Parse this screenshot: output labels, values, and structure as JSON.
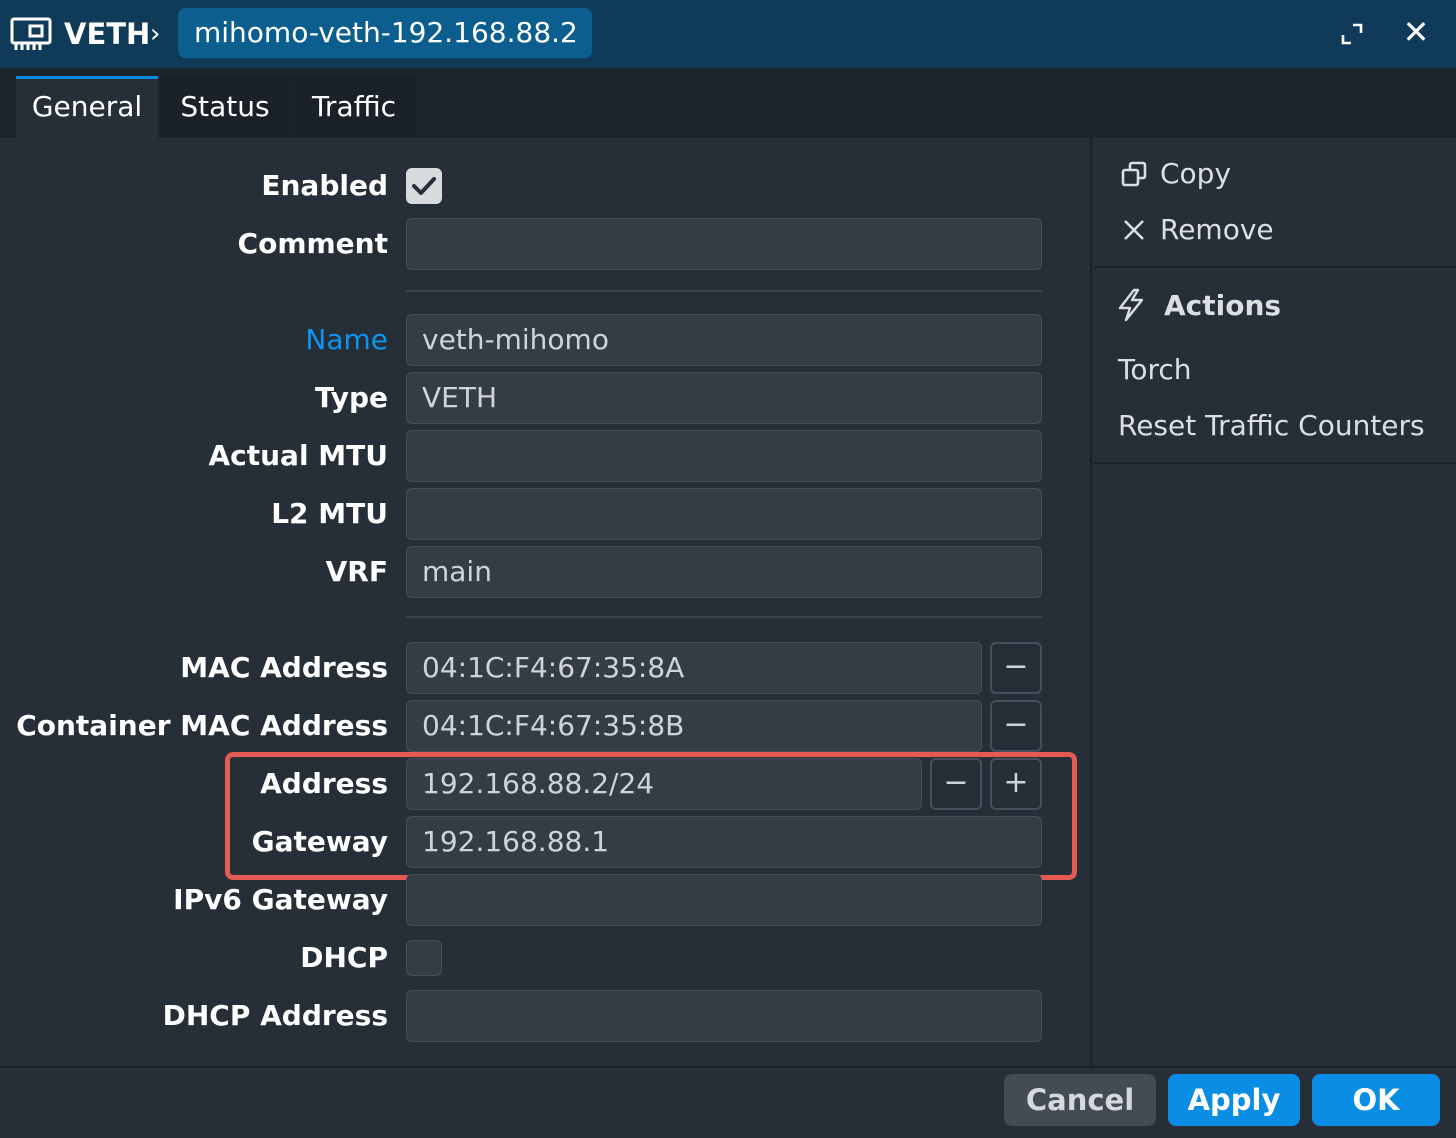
{
  "titlebar": {
    "type_label": "VETH",
    "separator": "›",
    "item_name": "mihomo-veth-192.168.88.2",
    "close_glyph": "✕"
  },
  "tabs": [
    {
      "label": "General",
      "active": true
    },
    {
      "label": "Status",
      "active": false
    },
    {
      "label": "Traffic",
      "active": false
    }
  ],
  "form": {
    "enabled": {
      "label": "Enabled",
      "checked": true
    },
    "comment": {
      "label": "Comment",
      "value": ""
    },
    "name": {
      "label": "Name",
      "value": "veth-mihomo"
    },
    "type": {
      "label": "Type",
      "value": "VETH"
    },
    "actual_mtu": {
      "label": "Actual MTU",
      "value": ""
    },
    "l2_mtu": {
      "label": "L2 MTU",
      "value": ""
    },
    "vrf": {
      "label": "VRF",
      "value": "main"
    },
    "mac_address": {
      "label": "MAC Address",
      "value": "04:1C:F4:67:35:8A"
    },
    "container_mac_address": {
      "label": "Container MAC Address",
      "value": "04:1C:F4:67:35:8B"
    },
    "address": {
      "label": "Address",
      "value": "192.168.88.2/24"
    },
    "gateway": {
      "label": "Gateway",
      "value": "192.168.88.1"
    },
    "ipv6_gateway": {
      "label": "IPv6 Gateway",
      "value": ""
    },
    "dhcp": {
      "label": "DHCP",
      "checked": false
    },
    "dhcp_address": {
      "label": "DHCP Address",
      "value": ""
    },
    "minus_glyph": "−",
    "plus_glyph": "+"
  },
  "side_panel": {
    "copy_label": "Copy",
    "remove_label": "Remove",
    "actions_heading": "Actions",
    "actions": [
      "Torch",
      "Reset Traffic Counters"
    ]
  },
  "footer": {
    "cancel_label": "Cancel",
    "apply_label": "Apply",
    "ok_label": "OK"
  },
  "colors": {
    "titlebar_bg": "#0f3a58",
    "chip_bg": "#0b5e8e",
    "accent": "#0a8ee3",
    "highlight_border": "#e55a52",
    "panel_bg": "#262e37"
  },
  "icons": {
    "window_type": "network-interface-icon",
    "expand": "expand-icon",
    "close": "close-icon",
    "copy": "copy-icon",
    "remove": "remove-x-icon",
    "actions": "lightning-icon",
    "check": "checkmark-icon"
  }
}
